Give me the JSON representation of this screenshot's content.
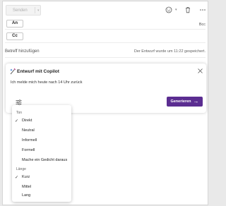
{
  "toolbar": {
    "send_label": "Senden",
    "icons": [
      "smiley-icon",
      "trash-icon",
      "more-icon"
    ]
  },
  "recipients": {
    "to_label": "An",
    "cc_label": "Cc",
    "bcc_label": "Bcc"
  },
  "subject": {
    "placeholder": "Betreff hinzufügen",
    "draft_status": "Der Entwurf wurde um 11:22 gespeichert."
  },
  "copilot": {
    "title": "Entwurf mit Copilot",
    "prompt": "Ich melde mich heute nach 14 Uhr zurück",
    "generate_label": "Generieren"
  },
  "options_menu": {
    "tone_header": "Ton",
    "tone_items": [
      {
        "label": "Direkt",
        "checked": true
      },
      {
        "label": "Neutral",
        "checked": false
      },
      {
        "label": "Informell",
        "checked": false
      },
      {
        "label": "Formell",
        "checked": false
      },
      {
        "label": "Mache ein Gedicht daraus",
        "checked": false
      }
    ],
    "length_header": "Länge",
    "length_items": [
      {
        "label": "Kurz",
        "checked": true
      },
      {
        "label": "Mittel",
        "checked": false
      },
      {
        "label": "Lang",
        "checked": false
      }
    ]
  },
  "colors": {
    "accent": "#5b2d91"
  }
}
